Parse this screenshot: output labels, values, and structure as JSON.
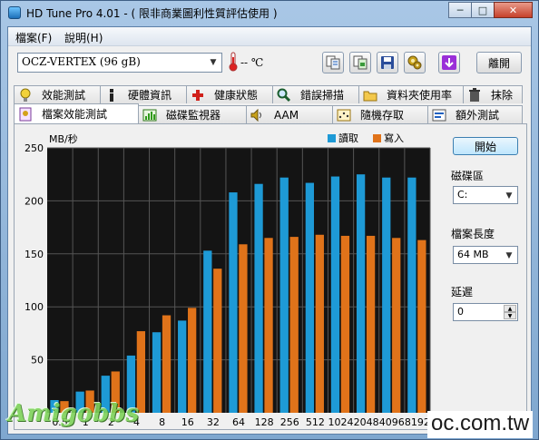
{
  "window": {
    "title": "HD Tune Pro 4.01 - ( 限非商業圖利性質評估使用 )",
    "min_label": "─",
    "max_label": "□",
    "close_label": "✕"
  },
  "menu": [
    "檔案(F)",
    "說明(H)"
  ],
  "toolbar": {
    "drive": "OCZ-VERTEX (96 gB)",
    "temperature": "-- ℃",
    "exit_label": "離開",
    "buttons": [
      "copy-text-icon",
      "copy-screen-icon",
      "save-icon",
      "options-icon",
      "download-icon"
    ]
  },
  "tabs_row1": [
    {
      "label": "效能測試",
      "icon": "benchmark-icon"
    },
    {
      "label": "硬體資訊",
      "icon": "info-icon"
    },
    {
      "label": "健康狀態",
      "icon": "health-icon"
    },
    {
      "label": "錯誤掃描",
      "icon": "error-scan-icon"
    },
    {
      "label": "資料夾使用率",
      "icon": "folder-usage-icon"
    },
    {
      "label": "抹除",
      "icon": "erase-icon"
    }
  ],
  "tabs_row2": [
    {
      "label": "檔案效能測試",
      "icon": "file-benchmark-icon",
      "active": true
    },
    {
      "label": "磁碟監視器",
      "icon": "disk-monitor-icon",
      "active": false
    },
    {
      "label": "AAM",
      "icon": "aam-icon",
      "active": false
    },
    {
      "label": "隨機存取",
      "icon": "random-access-icon",
      "active": false
    },
    {
      "label": "額外測試",
      "icon": "extra-tests-icon",
      "active": false
    }
  ],
  "side": {
    "start_label": "開始",
    "drive_label": "磁碟區",
    "drive_value": "C:",
    "file_length_label": "檔案長度",
    "file_length_value": "64 MB",
    "delay_label": "延遲",
    "delay_value": "0"
  },
  "watermark": "Amigobbs",
  "site_text": "oc.com.tw",
  "colors": {
    "read": "#1e9ad6",
    "write": "#e0731a",
    "plot_bg": "#141414",
    "grid": "#555555"
  },
  "chart_data": {
    "type": "bar",
    "ylabel": "MB/秒",
    "xlabel": "",
    "ylim": [
      0,
      250
    ],
    "yticks": [
      50,
      100,
      150,
      200,
      250
    ],
    "categories": [
      "0.5",
      "1",
      "2",
      "4",
      "8",
      "16",
      "32",
      "64",
      "128",
      "256",
      "512",
      "1024",
      "2048",
      "4096",
      "8192"
    ],
    "legend_position": "top-right",
    "grid": true,
    "series": [
      {
        "name": "讀取",
        "color": "#1e9ad6",
        "values": [
          12,
          20,
          35,
          54,
          76,
          87,
          153,
          208,
          216,
          222,
          217,
          223,
          225,
          222,
          222
        ]
      },
      {
        "name": "寫入",
        "color": "#e0731a",
        "values": [
          11,
          21,
          39,
          77,
          92,
          99,
          136,
          159,
          165,
          166,
          168,
          167,
          167,
          165,
          163
        ]
      }
    ]
  }
}
